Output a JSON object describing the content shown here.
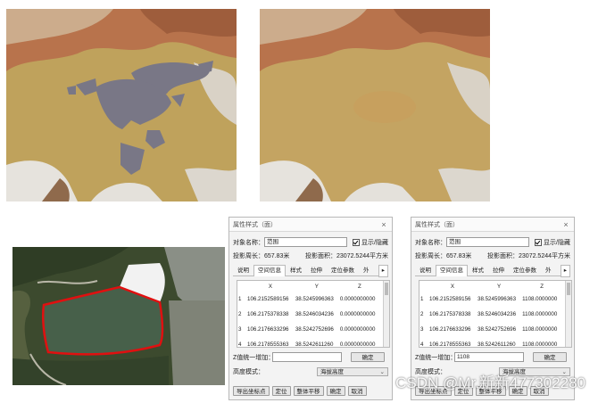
{
  "dialog_left": {
    "title": "属性样式（面）",
    "name_label": "对象名称：",
    "name_value": "范围",
    "show_label": "显示/隐藏",
    "perimeter_label": "投影周长：",
    "perimeter_value": "657.83米",
    "area_label": "投影面积：",
    "area_value": "23072.5244平方米",
    "tabs": [
      "说明",
      "空间信息",
      "样式",
      "拉伸",
      "定位参数",
      "外"
    ],
    "columns": [
      "X",
      "Y",
      "Z"
    ],
    "rows": [
      {
        "idx": "1",
        "x": "106.2152589156",
        "y": "38.5245996363",
        "z": "0.0000000000"
      },
      {
        "idx": "2",
        "x": "106.2175378338",
        "y": "38.5246034236",
        "z": "0.0000000000"
      },
      {
        "idx": "3",
        "x": "106.2176633296",
        "y": "38.5242752696",
        "z": "0.0000000000"
      },
      {
        "idx": "4",
        "x": "106.2178555363",
        "y": "38.5242611260",
        "z": "0.0000000000"
      }
    ],
    "z_label": "Z值统一增加：",
    "z_value": "",
    "confirm_label": "确定",
    "height_mode_label": "高度模式：",
    "height_mode_value": "海拔高度",
    "buttons": [
      "导出坐标点",
      "定位",
      "整体平移",
      "确定",
      "取消"
    ]
  },
  "dialog_right": {
    "title": "属性样式（面）",
    "name_label": "对象名称：",
    "name_value": "范围",
    "show_label": "显示/隐藏",
    "perimeter_label": "投影周长：",
    "perimeter_value": "657.83米",
    "area_label": "投影面积：",
    "area_value": "23072.5244平方米",
    "tabs": [
      "说明",
      "空间信息",
      "样式",
      "拉伸",
      "定位参数",
      "外"
    ],
    "columns": [
      "X",
      "Y",
      "Z"
    ],
    "rows": [
      {
        "idx": "1",
        "x": "106.2152589156",
        "y": "38.5245996363",
        "z": "1108.0000000"
      },
      {
        "idx": "2",
        "x": "106.2175378338",
        "y": "38.5246034236",
        "z": "1108.0000000"
      },
      {
        "idx": "3",
        "x": "106.2176633296",
        "y": "38.5242752696",
        "z": "1108.0000000"
      },
      {
        "idx": "4",
        "x": "106.2178555363",
        "y": "38.5242611260",
        "z": "1108.0000000"
      }
    ],
    "z_label": "Z值统一增加：",
    "z_value": "1108",
    "confirm_label": "确定",
    "height_mode_label": "高度模式：",
    "height_mode_value": "海拔高度",
    "buttons": [
      "导出坐标点",
      "定位",
      "整体平移",
      "确定",
      "取消"
    ]
  },
  "watermark": "CSDN @Mr.新新477302280",
  "colors": {
    "water": "#c0a15a",
    "cutout": "#797786",
    "polygon": "#e01010",
    "rock": "#c76a45"
  }
}
